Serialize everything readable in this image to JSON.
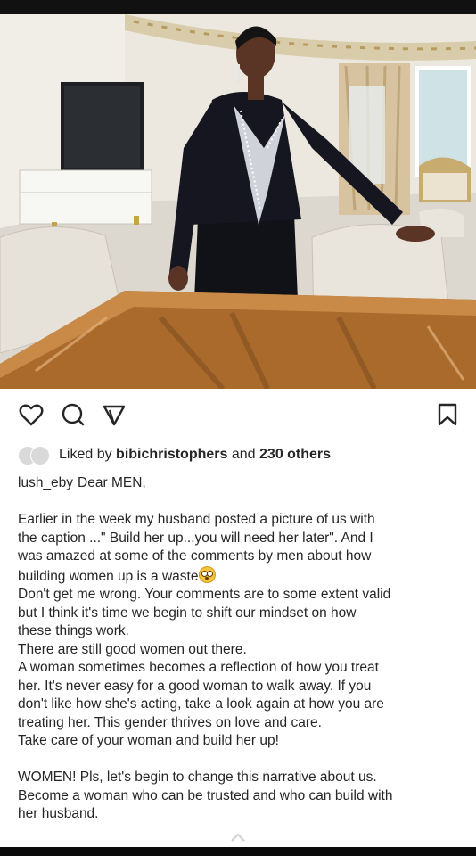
{
  "post": {
    "image_icon": "photo-woman-in-velvet-suit",
    "actions": {
      "like_icon": "heart-icon",
      "comment_icon": "comment-icon",
      "share_icon": "send-icon",
      "save_icon": "bookmark-icon"
    },
    "likes": {
      "prefix": "Liked by",
      "user": "bibichristophers",
      "middle": "and",
      "others": "230 others"
    },
    "caption": {
      "username": "lush_eby",
      "first_line": "Dear MEN,",
      "paragraphs": [
        "Earlier in the week my husband posted a picture of us with",
        "the caption ...\" Build her up...you will need her later\". And I",
        "was amazed at some of the comments by men about how",
        "building women up is a waste",
        "Don't get me wrong. Your comments are to some extent valid",
        "but I think it's time we begin to shift our mindset on how",
        "these things work.",
        "There are still good women out there.",
        "A woman sometimes becomes a reflection of how you treat",
        "her. It's never easy for a good woman to walk away. If you",
        "don't like how she's acting, take a look again at how you are",
        "treating her. This gender thrives on love and care.",
        "Take care of your woman and build her up!",
        "WOMEN! Pls, let's begin to change this narrative about us.",
        "Become a woman who can be trusted and who can build with",
        "her husband."
      ],
      "emoji_icon": "flushed-face-emoji-icon"
    },
    "expand_icon": "chevron-up-icon"
  },
  "colors": {
    "text": "#262626",
    "background": "#ffffff",
    "icon": "#262626"
  }
}
